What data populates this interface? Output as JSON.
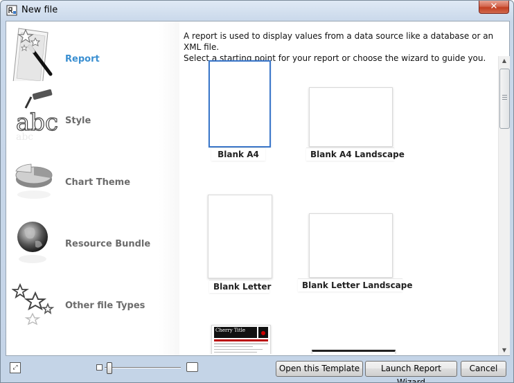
{
  "window": {
    "title": "New file",
    "close_label": "✕"
  },
  "sidebar": {
    "items": [
      {
        "label": "Report",
        "active": true
      },
      {
        "label": "Style"
      },
      {
        "label": "Chart Theme"
      },
      {
        "label": "Resource Bundle"
      },
      {
        "label": "Other file Types"
      }
    ]
  },
  "main": {
    "description_line1": "A report is used to display values from a data source like a database or an XML file.",
    "description_line2": "Select a starting point for your report or choose the wizard to guide you.",
    "templates": [
      {
        "label": "Blank A4",
        "selected": true
      },
      {
        "label": "Blank A4 Landscape"
      },
      {
        "label": "Blank Letter"
      },
      {
        "label": "Blank Letter Landscape"
      }
    ],
    "preview_title": "Cherry Title"
  },
  "footer": {
    "open_template": "Open this Template",
    "launch_wizard": "Launch Report Wizard",
    "cancel": "Cancel"
  },
  "colors": {
    "accent": "#3a8fd1",
    "selection": "#3b77c9"
  }
}
